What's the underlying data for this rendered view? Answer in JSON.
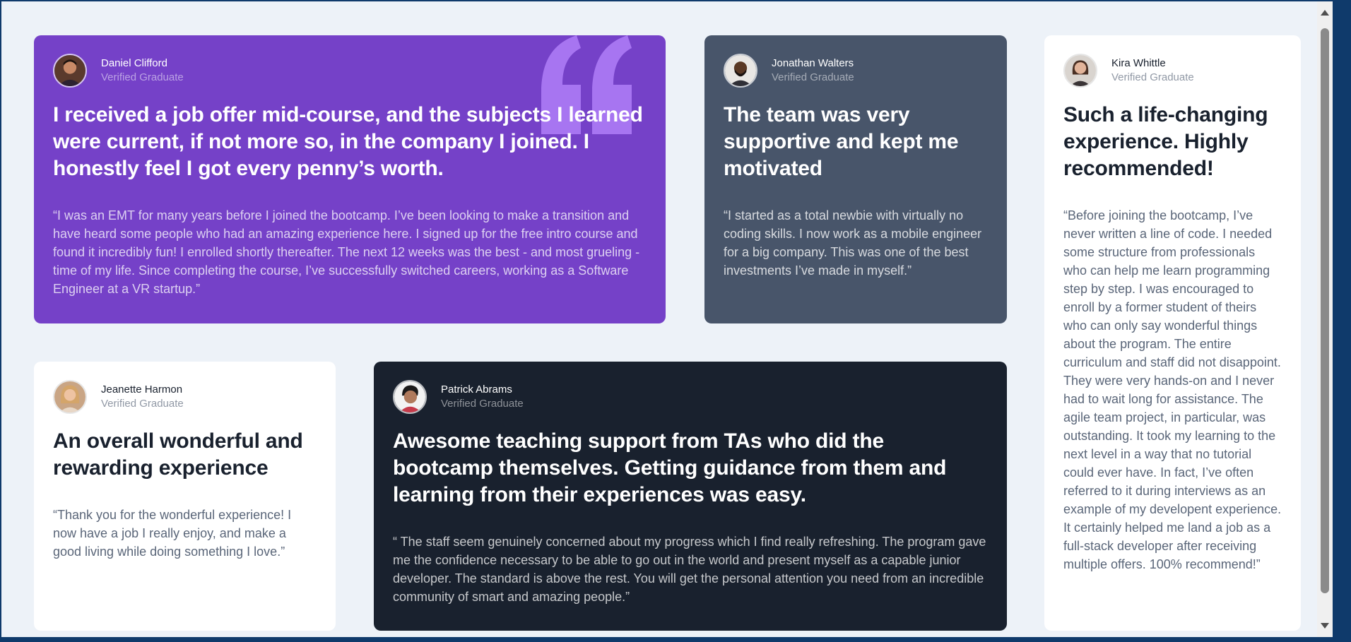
{
  "accent": {
    "purple": "#7541c8",
    "grayish_blue": "#48556a",
    "dark_blue": "#19212e",
    "white": "#ffffff",
    "background": "#edf2f8"
  },
  "testimonials": [
    {
      "name": "Daniel Clifford",
      "role": "Verified Graduate",
      "headline": "I received a job offer mid-course, and the subjects I learned were current, if not more so, in the company I joined. I honestly feel I got every penny’s worth.",
      "quote": "“I was an EMT for many years before I joined the bootcamp. I’ve been looking to make a transition and have heard some people who had an amazing experience here. I signed up for the free intro course and found it incredibly fun! I enrolled shortly thereafter. The next 12 weeks was the best - and most grueling - time of my life. Since completing the course, I’ve successfully switched careers, working as a Software Engineer at a VR startup.”"
    },
    {
      "name": "Jonathan Walters",
      "role": "Verified Graduate",
      "headline": "The team was very supportive and kept me motivated",
      "quote": "“I started as a total newbie with virtually no coding skills. I now work as a mobile engineer for a big company. This was one of the best investments I’ve made in myself.”"
    },
    {
      "name": "Kira Whittle",
      "role": "Verified Graduate",
      "headline": "Such a life-changing experience. Highly recommended!",
      "quote": "“Before joining the bootcamp, I’ve never written a line of code. I needed some structure from professionals who can help me learn programming step by step. I was encouraged to enroll by a former student of theirs who can only say wonderful things about the program. The entire curriculum and staff did not disappoint. They were very hands-on and I never had to wait long for assistance. The agile team project, in particular, was outstanding. It took my learning to the next level in a way that no tutorial could ever have. In fact, I’ve often referred to it during interviews as an example of my developent experience. It certainly helped me land a job as a full-stack developer after receiving multiple offers. 100% recommend!”"
    },
    {
      "name": "Jeanette Harmon",
      "role": "Verified Graduate",
      "headline": "An overall wonderful and rewarding experience",
      "quote": "“Thank you for the wonderful experience! I now have a job I really enjoy, and make a good living while doing something I love.”"
    },
    {
      "name": "Patrick Abrams",
      "role": "Verified Graduate",
      "headline": "Awesome teaching support from TAs who did the bootcamp themselves. Getting guidance from them and learning from their experiences was easy.",
      "quote": "“ The staff seem genuinely concerned about my progress which I find really refreshing. The program gave me the confidence necessary to be able to go out in the world and present myself as a capable junior developer. The standard is above the rest. You will get the personal attention you need from an incredible community of smart and amazing people.”"
    }
  ]
}
